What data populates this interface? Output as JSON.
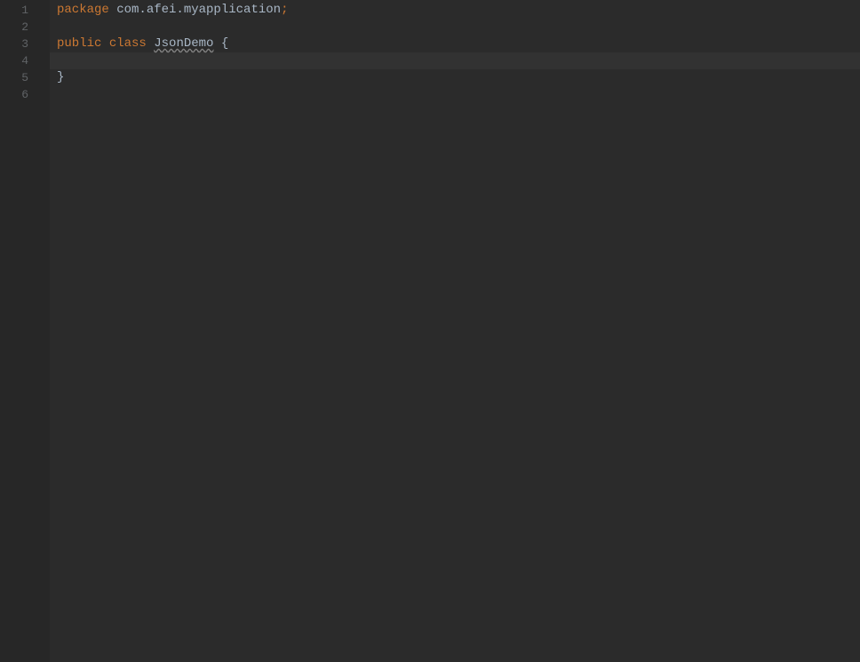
{
  "gutter": {
    "lines": [
      "1",
      "2",
      "3",
      "4",
      "5",
      "6"
    ]
  },
  "code": {
    "line1": {
      "keyword": "package",
      "space1": " ",
      "package_name": "com.afei.myapplication",
      "semicolon": ";"
    },
    "line3": {
      "kw_public": "public",
      "space1": " ",
      "kw_class": "class",
      "space2": " ",
      "class_name": "JsonDemo",
      "space3": " ",
      "brace_open": "{"
    },
    "line5": {
      "brace_close": "}"
    }
  }
}
